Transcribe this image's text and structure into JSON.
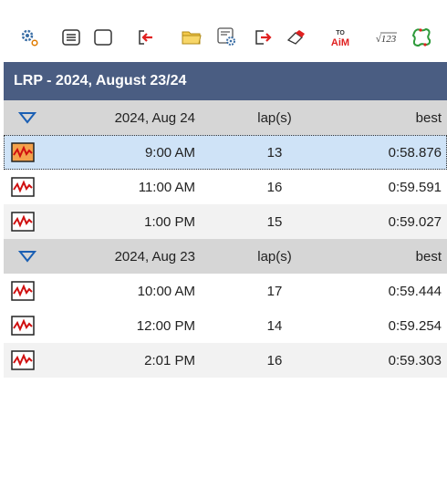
{
  "toolbar": {
    "items": [
      {
        "icon": "gear-settings-icon"
      },
      {
        "icon": "list-view-icon"
      },
      {
        "icon": "blank-square-icon"
      },
      {
        "icon": "import-icon"
      },
      {
        "icon": "folder-icon"
      },
      {
        "icon": "settings-window-icon"
      },
      {
        "icon": "export-icon"
      },
      {
        "icon": "eraser-icon"
      },
      {
        "icon": "to-aim-icon",
        "text_top": "TO",
        "text_bottom": "AiM"
      },
      {
        "icon": "math-channel-icon",
        "text": "√123"
      },
      {
        "icon": "track-map-icon"
      }
    ]
  },
  "session": {
    "title": "LRP - 2024, August 23/24"
  },
  "groups": [
    {
      "date": "2024, Aug 24",
      "laps_header": "lap(s)",
      "best_header": "best",
      "rows": [
        {
          "time": "9:00 AM",
          "laps": "13",
          "best": "0:58.876",
          "selected": true
        },
        {
          "time": "11:00 AM",
          "laps": "16",
          "best": "0:59.591",
          "selected": false
        },
        {
          "time": "1:00 PM",
          "laps": "15",
          "best": "0:59.027",
          "selected": false
        }
      ]
    },
    {
      "date": "2024, Aug 23",
      "laps_header": "lap(s)",
      "best_header": "best",
      "rows": [
        {
          "time": "10:00 AM",
          "laps": "17",
          "best": "0:59.444",
          "selected": false
        },
        {
          "time": "12:00 PM",
          "laps": "14",
          "best": "0:59.254",
          "selected": false
        },
        {
          "time": "2:01 PM",
          "laps": "16",
          "best": "0:59.303",
          "selected": false
        }
      ]
    }
  ],
  "colors": {
    "header_bg": "#4a5d82",
    "group_bg": "#d6d6d6",
    "selected_bg": "#cfe3f7",
    "accent_red": "#e02020",
    "triangle_blue": "#1a5fb4"
  }
}
